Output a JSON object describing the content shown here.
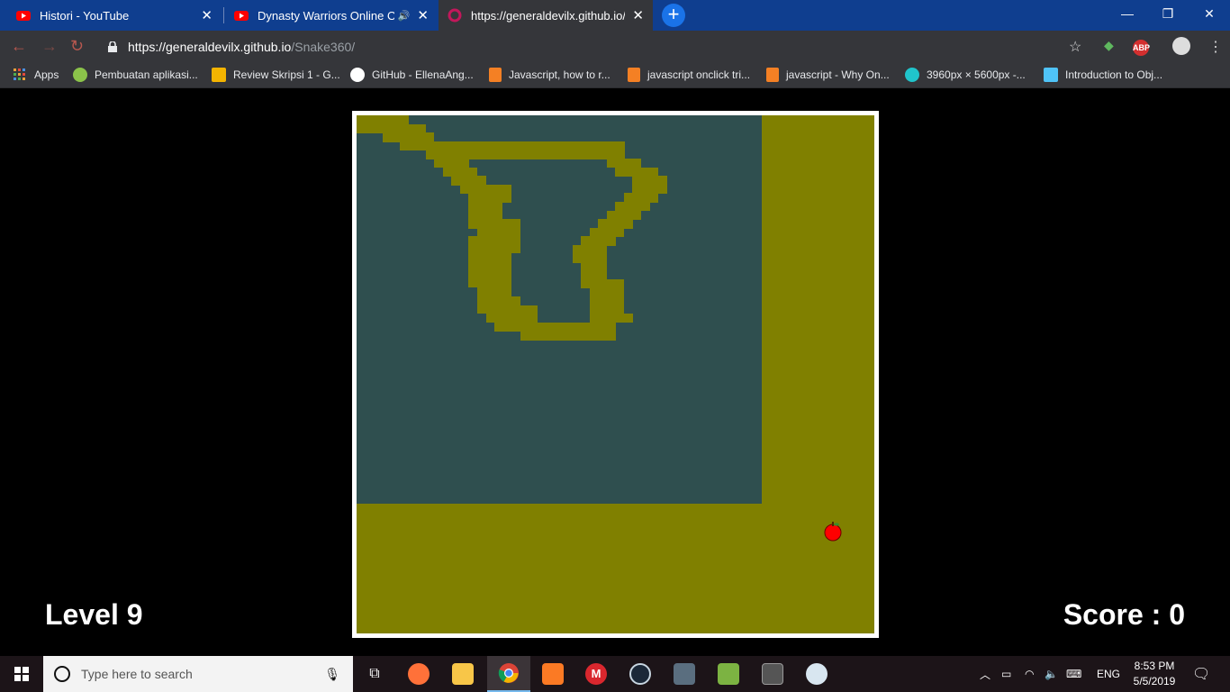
{
  "browser": {
    "tabs": [
      {
        "title": "Histori - YouTube",
        "icon": "youtube-icon"
      },
      {
        "title": "Dynasty Warriors Online OST",
        "icon": "youtube-icon"
      },
      {
        "title": "https://generaldevilx.github.io/Sn",
        "icon": "site-icon"
      }
    ],
    "new_tab_label": "+",
    "address": {
      "host": "https://generaldevilx.github.io",
      "path": "/Snake360/"
    },
    "bookmarks": [
      {
        "label": "Apps",
        "icon": "apps-grid-icon",
        "color": "#e8eaed"
      },
      {
        "label": "Pembuatan aplikasi...",
        "icon": "android-icon",
        "color": "#8bc34a"
      },
      {
        "label": "Review Skripsi 1 - G...",
        "icon": "slides-icon",
        "color": "#f4b400"
      },
      {
        "label": "GitHub - EllenaAng...",
        "icon": "github-icon",
        "color": "#ffffff"
      },
      {
        "label": "Javascript, how to r...",
        "icon": "stackoverflow-icon",
        "color": "#f48024"
      },
      {
        "label": "javascript onclick tri...",
        "icon": "stackoverflow-icon",
        "color": "#f48024"
      },
      {
        "label": "javascript - Why On...",
        "icon": "stackoverflow-icon",
        "color": "#f48024"
      },
      {
        "label": "3960px × 5600px -...",
        "icon": "canva-icon",
        "color": "#20c4cb"
      },
      {
        "label": "Introduction to Obj...",
        "icon": "course-icon",
        "color": "#4fc3f7"
      }
    ]
  },
  "game": {
    "level_label": "Level 9",
    "score_label": "Score : 0",
    "colors": {
      "snake": "#808000",
      "field": "#2f4f4f",
      "frame": "#ffffff",
      "apple": "#ff0000"
    }
  },
  "taskbar": {
    "search_placeholder": "Type here to search",
    "apps": [
      "task-view-icon",
      "firefox-icon",
      "file-explorer-icon",
      "chrome-icon",
      "xampp-icon",
      "mega-icon",
      "steam-icon",
      "video-editor-icon",
      "notepad-icon",
      "tex-icon",
      "paint-icon"
    ],
    "language": "ENG",
    "time": "8:53 PM",
    "date": "5/5/2019"
  }
}
